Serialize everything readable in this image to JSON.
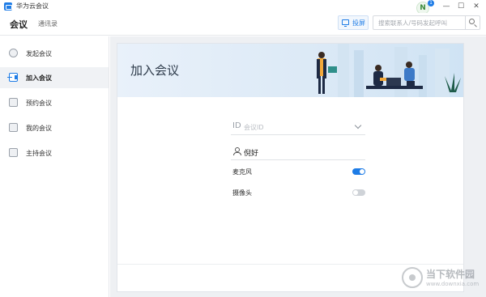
{
  "app": {
    "title": "华为云会议"
  },
  "window": {
    "avatar_letter": "N",
    "badge_count": "1",
    "minimize": "—",
    "maximize": "☐",
    "close": "✕"
  },
  "topnav": {
    "tabs": [
      "会议",
      "通讯录"
    ]
  },
  "cast": {
    "label": "投屏"
  },
  "search": {
    "placeholder": "搜索联系人/号码发起呼叫"
  },
  "sidebar": {
    "items": [
      {
        "label": "发起会议",
        "icon": "start-meeting-icon"
      },
      {
        "label": "加入会议",
        "icon": "join-meeting-icon",
        "active": true
      },
      {
        "label": "预约会议",
        "icon": "schedule-meeting-icon"
      },
      {
        "label": "我的会议",
        "icon": "my-meetings-icon"
      },
      {
        "label": "主持会议",
        "icon": "host-meeting-icon"
      }
    ]
  },
  "join": {
    "banner_title": "加入会议",
    "id_label": "ID",
    "id_placeholder": "会议ID",
    "name_value": "倪好",
    "mic_label": "麦克风",
    "mic_on": true,
    "camera_label": "摄像头",
    "camera_on": false
  },
  "watermark": {
    "text": "当下软件园",
    "url": "www.downxia.com"
  },
  "colors": {
    "accent": "#1e7ce6",
    "sidebar_active": "#f0f2f5",
    "main_bg": "#eef0f3"
  }
}
